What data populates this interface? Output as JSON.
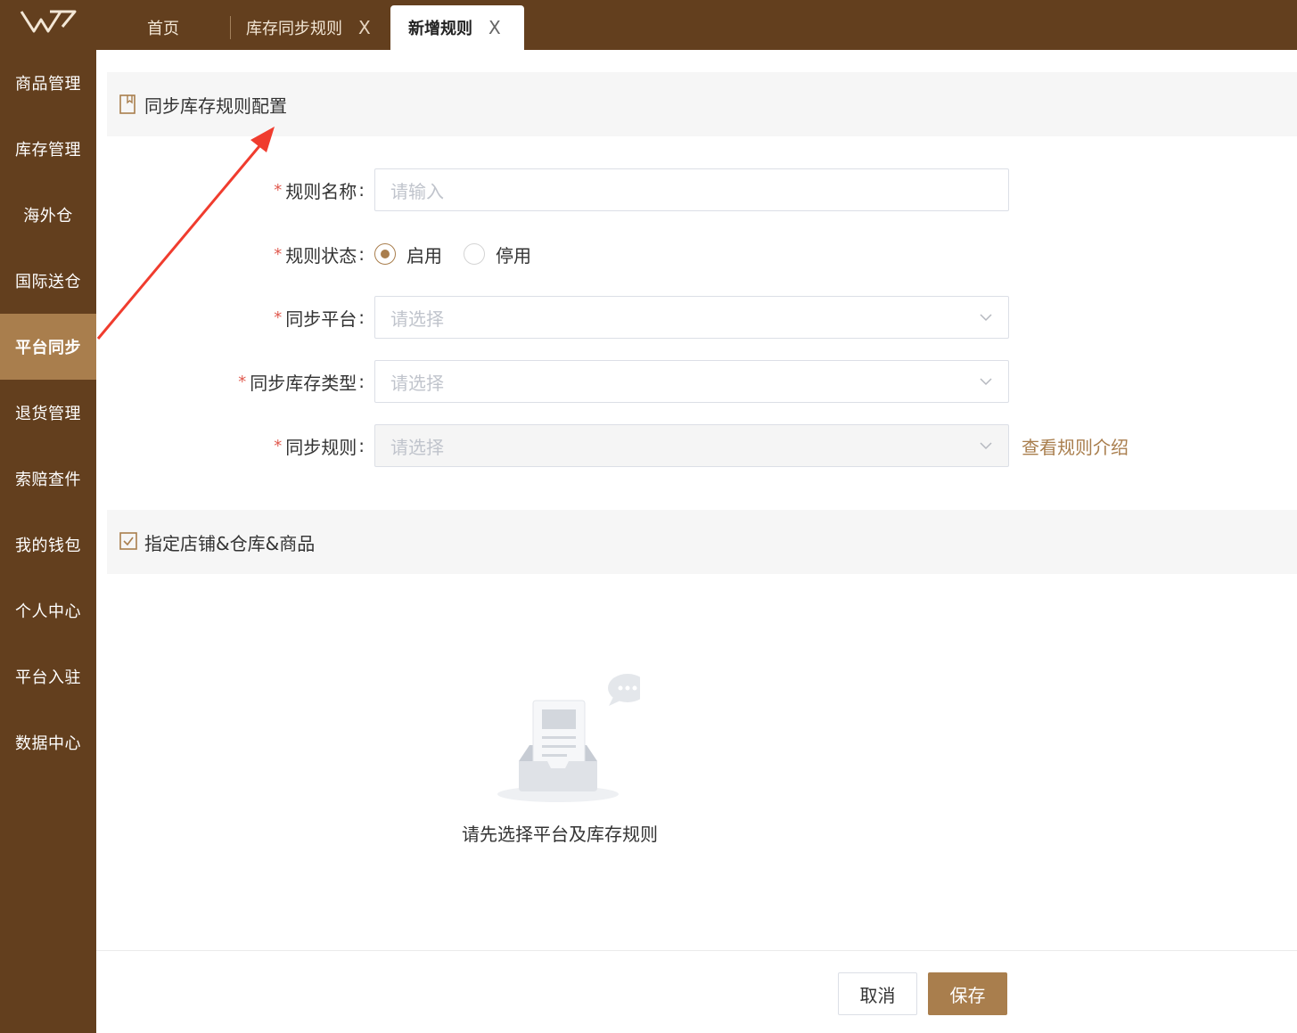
{
  "header": {
    "tabs": [
      {
        "label": "首页",
        "closable": false,
        "active": false
      },
      {
        "label": "库存同步规则",
        "closable": true,
        "active": false
      },
      {
        "label": "新增规则",
        "closable": true,
        "active": true
      }
    ],
    "close_glyph": "X"
  },
  "sidebar": {
    "items": [
      {
        "label": "商品管理",
        "active": false
      },
      {
        "label": "库存管理",
        "active": false
      },
      {
        "label": "海外仓",
        "active": false
      },
      {
        "label": "国际送仓",
        "active": false
      },
      {
        "label": "平台同步",
        "active": true
      },
      {
        "label": "退货管理",
        "active": false
      },
      {
        "label": "索赔查件",
        "active": false
      },
      {
        "label": "我的钱包",
        "active": false
      },
      {
        "label": "个人中心",
        "active": false
      },
      {
        "label": "平台入驻",
        "active": false
      },
      {
        "label": "数据中心",
        "active": false
      }
    ]
  },
  "section1": {
    "title": "同步库存规则配置",
    "icon": "bookmark-icon"
  },
  "form": {
    "rule_name": {
      "label": "规则名称",
      "placeholder": "请输入",
      "value": ""
    },
    "rule_status": {
      "label": "规则状态",
      "options": [
        "启用",
        "停用"
      ],
      "selected": "启用"
    },
    "sync_platform": {
      "label": "同步平台",
      "placeholder": "请选择"
    },
    "stock_type": {
      "label": "同步库存类型",
      "placeholder": "请选择"
    },
    "sync_rule": {
      "label": "同步规则",
      "placeholder": "请选择",
      "disabled": true,
      "link": "查看规则介绍"
    },
    "required_mark": "*",
    "colon": ":"
  },
  "section2": {
    "title": "指定店铺&仓库&商品",
    "icon": "checkbox-icon"
  },
  "empty_state": {
    "text": "请先选择平台及库存规则",
    "icon": "empty-inbox-icon"
  },
  "footer": {
    "cancel_label": "取消",
    "save_label": "保存"
  },
  "colors": {
    "brand_dark": "#633f1e",
    "accent": "#a97e4d",
    "required": "#e05a4f",
    "annotation": "#f03c2e"
  }
}
